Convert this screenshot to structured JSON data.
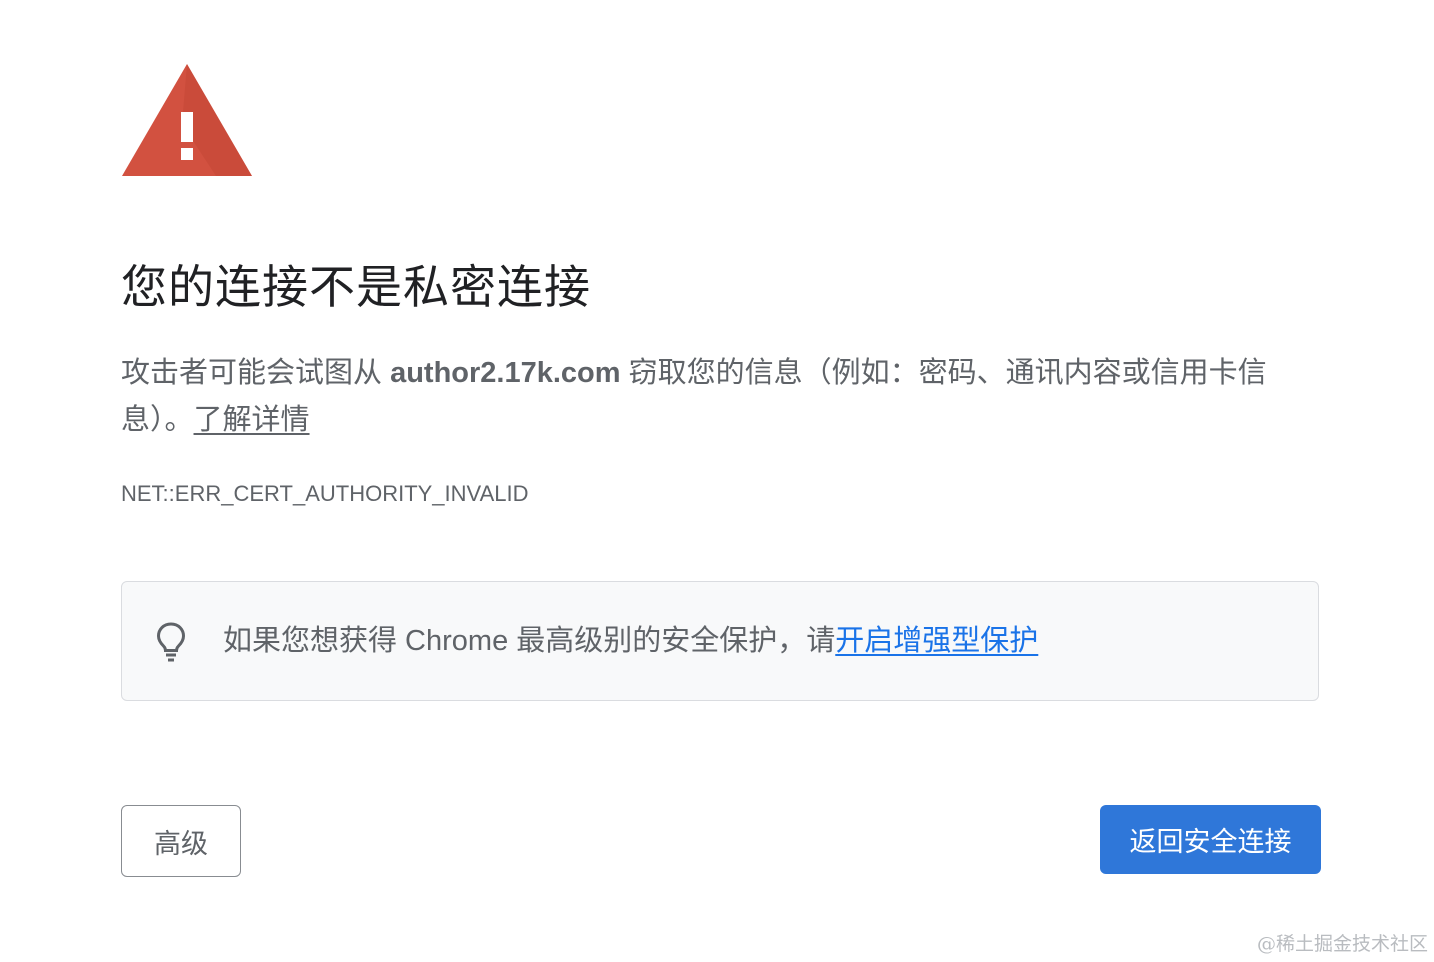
{
  "icons": {
    "warning": "warning-triangle-icon",
    "bulb": "lightbulb-icon"
  },
  "colors": {
    "warning_red": "#d25140",
    "link_blue": "#1a73e8",
    "primary_button": "#2f77d9"
  },
  "heading": {
    "title": "您的连接不是私密连接"
  },
  "description": {
    "prefix": "攻击者可能会试图从 ",
    "domain": "author2.17k.com",
    "suffix": " 窃取您的信息（例如：密码、通讯内容或信用卡信息）。",
    "learn_more": "了解详情"
  },
  "error_code": "NET::ERR_CERT_AUTHORITY_INVALID",
  "protection": {
    "text": "如果您想获得 Chrome 最高级别的安全保护，请",
    "link": "开启增强型保护"
  },
  "buttons": {
    "advanced": "高级",
    "back_to_safety": "返回安全连接"
  },
  "watermark": "@稀土掘金技术社区"
}
